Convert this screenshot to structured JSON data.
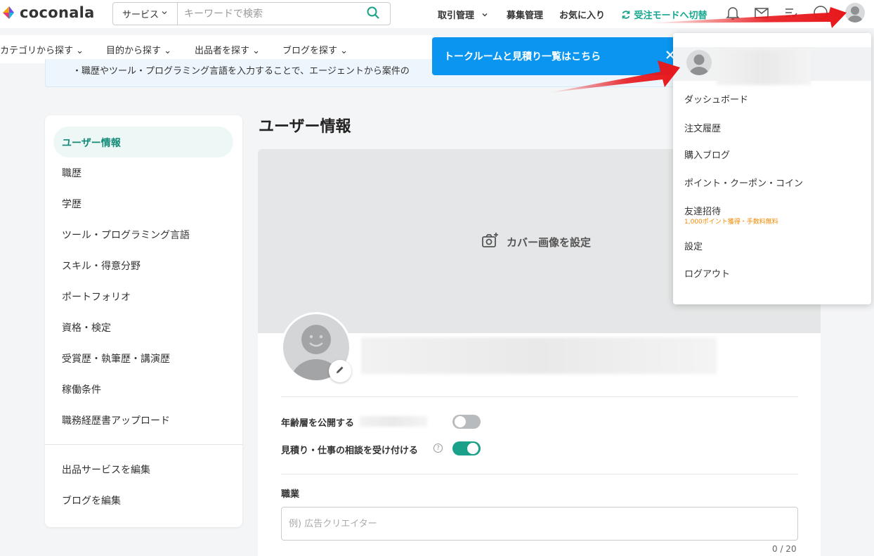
{
  "brand": {
    "name": "coconala"
  },
  "search": {
    "category_label": "サービス",
    "placeholder": "キーワードで検索"
  },
  "header_nav": {
    "transactions": "取引管理",
    "recruitment": "募集管理",
    "favorites": "お気に入り",
    "mode_switch": "受注モードへ切替"
  },
  "category_nav": [
    "カテゴリから探す",
    "目的から探す",
    "出品者を探す",
    "ブログを探す"
  ],
  "banner": {
    "text": "・職歴やツール・プログラミング言語を入力することで、エージェントから案件の"
  },
  "tooltip": {
    "text": "トークルームと見積り一覧はこちら"
  },
  "sidebar": {
    "items": [
      "ユーザー情報",
      "職歴",
      "学歴",
      "ツール・プログラミング言語",
      "スキル・得意分野",
      "ポートフォリオ",
      "資格・検定",
      "受賞歴・執筆歴・講演歴",
      "稼働条件",
      "職務経歴書アップロード"
    ],
    "footer_items": [
      "出品サービスを編集",
      "ブログを編集"
    ]
  },
  "main": {
    "title": "ユーザー情報",
    "cover_label": "カバー画像を設定",
    "toggles": [
      {
        "label": "年齢層を公開する",
        "on": false
      },
      {
        "label": "見積り・仕事の相談を受け付ける",
        "on": true
      }
    ],
    "help_glyph": "?",
    "occupation": {
      "label": "職業",
      "placeholder": "例) 広告クリエイター",
      "counter": "0 / 20"
    }
  },
  "dropdown": {
    "items": [
      "ダッシュボード",
      "注文履歴",
      "購入ブログ",
      "ポイント・クーポン・コイン",
      "友達招待",
      "設定",
      "ログアウト"
    ],
    "invite_note": "1,000ポイント獲得・手数料無料"
  },
  "colors": {
    "accent_green": "#1ba189",
    "tooltip_blue": "#0a96f0",
    "arrow_red": "#e8171b",
    "note_orange": "#f08a00"
  },
  "icons": {
    "search": "search-icon",
    "bell": "bell-icon",
    "mail": "mail-icon",
    "checklist": "checklist-icon",
    "help": "help-icon",
    "camera": "camera-plus-icon",
    "pencil": "pencil-icon",
    "close": "close-icon",
    "refresh": "refresh-icon"
  }
}
